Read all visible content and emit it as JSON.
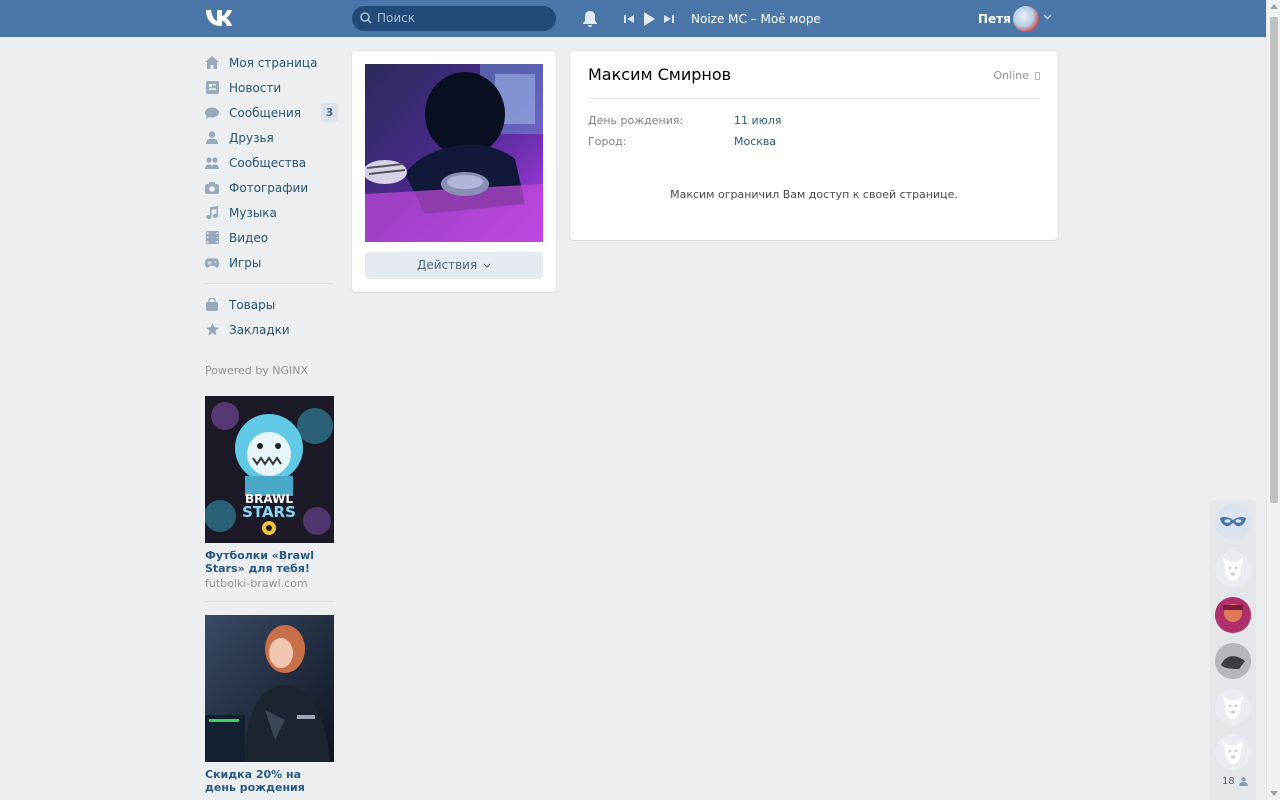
{
  "header": {
    "search_placeholder": "Поиск",
    "now_playing_artist": "Noize MC",
    "now_playing_sep": " – ",
    "now_playing_title": "Моё море",
    "user_name": "Петя"
  },
  "nav": {
    "items": [
      {
        "label": "Моя страница",
        "icon": "home-icon"
      },
      {
        "label": "Новости",
        "icon": "news-icon"
      },
      {
        "label": "Сообщения",
        "icon": "messages-icon",
        "badge": "3"
      },
      {
        "label": "Друзья",
        "icon": "friends-icon"
      },
      {
        "label": "Сообщества",
        "icon": "communities-icon"
      },
      {
        "label": "Фотографии",
        "icon": "camera-icon"
      },
      {
        "label": "Музыка",
        "icon": "music-icon"
      },
      {
        "label": "Видео",
        "icon": "video-icon"
      },
      {
        "label": "Игры",
        "icon": "gamepad-icon"
      }
    ],
    "items2": [
      {
        "label": "Товары",
        "icon": "bag-icon"
      },
      {
        "label": "Закладки",
        "icon": "star-icon"
      }
    ],
    "powered": "Powered by NGINX"
  },
  "ads": [
    {
      "title": "Футболки «Brawl Stars» для тебя!",
      "domain": "futbolki-brawl.com",
      "image_text_1": "BRAWL",
      "image_text_2": "STARS"
    },
    {
      "title": "Скидка 20% на день рождения",
      "domain": ""
    }
  ],
  "profile": {
    "actions_label": "Действия",
    "name": "Максим Смирнов",
    "status": "Online",
    "birthday_label": "День рождения:",
    "birthday_value": "11 июля",
    "city_label": "Город:",
    "city_value": "Москва",
    "restricted_text": "Максим ограничил Вам доступ к своей странице."
  },
  "chatbar": {
    "online_count": "18"
  },
  "colors": {
    "header": "#4a76a8",
    "link": "#2a5885",
    "background": "#edeef0"
  }
}
